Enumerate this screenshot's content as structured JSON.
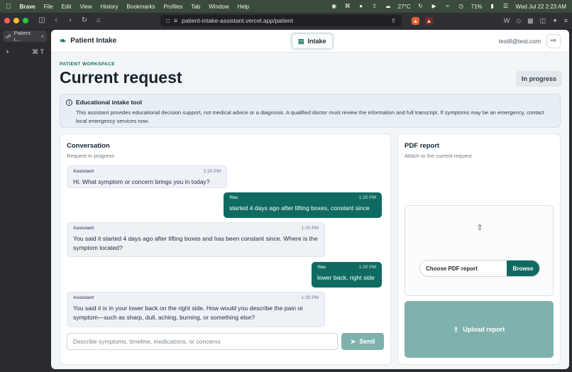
{
  "menubar": {
    "app_name": "Brave",
    "items": [
      "File",
      "Edit",
      "View",
      "History",
      "Bookmarks",
      "Profiles",
      "Tab",
      "Window",
      "Help"
    ],
    "weather": "27°C",
    "battery": "71%",
    "datetime": "Wed Jul 22  2:23 AM"
  },
  "browser": {
    "url": "patient-intake-assistant.vercel.app/patient",
    "tab_title": "Patient I..."
  },
  "app": {
    "brand": "Patient Intake",
    "nav_tab": "Intake",
    "user_email": "test8@test.com",
    "eyebrow": "PATIENT WORKSPACE",
    "title": "Current request",
    "status": "In progress"
  },
  "notice": {
    "title": "Educational intake tool",
    "body": "This assistant provides educational decision support, not medical advice or a diagnosis. A qualified doctor must review the information and full transcript. If symptoms may be an emergency, contact local emergency services now."
  },
  "conversation": {
    "title": "Conversation",
    "subtitle": "Request in progress",
    "messages": [
      {
        "role": "assistant",
        "author": "Assistant",
        "time": "1:20 PM",
        "text": "Hi. What symptom or concern brings you in today?"
      },
      {
        "role": "you",
        "author": "You",
        "time": "1:20 PM",
        "text": "started 4 days ago after lifting boxes, constant since"
      },
      {
        "role": "assistant",
        "author": "Assistant",
        "time": "1:20 PM",
        "text": "You said it started 4 days ago after lifting boxes and has been constant since. Where is the symptom located?"
      },
      {
        "role": "you",
        "author": "You",
        "time": "1:20 PM",
        "text": "lower back, right side"
      },
      {
        "role": "assistant",
        "author": "Assistant",
        "time": "1:20 PM",
        "text": "You said it is in your lower back on the right side. How would you describe the pain or symptom—such as sharp, dull, aching, burning, or something else?"
      }
    ],
    "input_placeholder": "Describe symptoms, timeline, medications, or concerns",
    "send_label": "Send"
  },
  "pdf": {
    "title": "PDF report",
    "subtitle": "Attach to the current request",
    "choose_label": "Choose PDF report",
    "browse_label": "Browse",
    "upload_label": "Upload report"
  }
}
